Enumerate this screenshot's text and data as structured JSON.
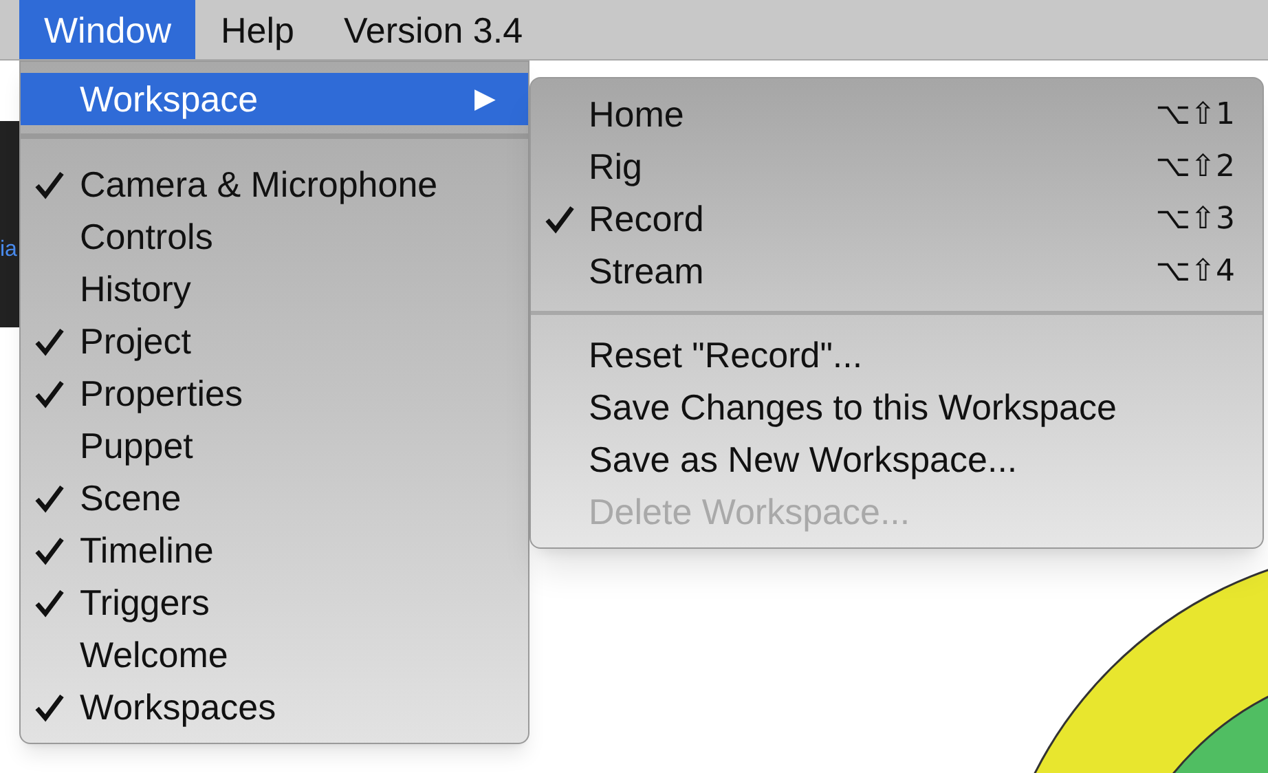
{
  "menu_bar": [
    {
      "label": "Window",
      "selected": true
    },
    {
      "label": "Help",
      "selected": false
    },
    {
      "label": "Version 3.4",
      "selected": false
    }
  ],
  "background": {
    "tab_fragment": "ia"
  },
  "window_menu": {
    "submenu_item": {
      "label": "Workspace",
      "selected": true,
      "arrow": "▶"
    },
    "items": [
      {
        "label": "Camera & Microphone",
        "checked": true
      },
      {
        "label": "Controls",
        "checked": false
      },
      {
        "label": "History",
        "checked": false
      },
      {
        "label": "Project",
        "checked": true
      },
      {
        "label": "Properties",
        "checked": true
      },
      {
        "label": "Puppet",
        "checked": false
      },
      {
        "label": "Scene",
        "checked": true
      },
      {
        "label": "Timeline",
        "checked": true
      },
      {
        "label": "Triggers",
        "checked": true
      },
      {
        "label": "Welcome",
        "checked": false
      },
      {
        "label": "Workspaces",
        "checked": true
      }
    ]
  },
  "workspace_submenu": {
    "workspaces": [
      {
        "label": "Home",
        "shortcut": "⌥⇧1",
        "checked": false
      },
      {
        "label": "Rig",
        "shortcut": "⌥⇧2",
        "checked": false
      },
      {
        "label": "Record",
        "shortcut": "⌥⇧3",
        "checked": true
      },
      {
        "label": "Stream",
        "shortcut": "⌥⇧4",
        "checked": false
      }
    ],
    "actions": [
      {
        "label": "Reset \"Record\"...",
        "disabled": false
      },
      {
        "label": "Save Changes to this Workspace",
        "disabled": false
      },
      {
        "label": "Save as New Workspace...",
        "disabled": false
      },
      {
        "label": "Delete Workspace...",
        "disabled": true
      }
    ]
  }
}
